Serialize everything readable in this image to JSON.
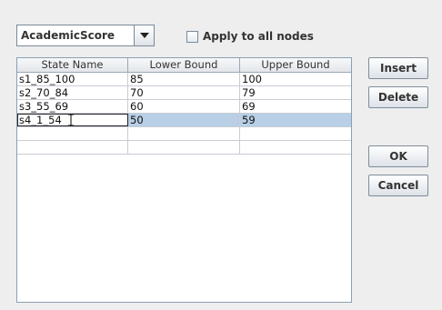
{
  "combo": {
    "value": "AcademicScore"
  },
  "apply_all": {
    "label": "Apply to all nodes",
    "checked": false
  },
  "table": {
    "headers": [
      "State Name",
      "Lower Bound",
      "Upper Bound"
    ],
    "rows": [
      [
        "s1_85_100",
        "85",
        "100"
      ],
      [
        "s2_70_84",
        "70",
        "79"
      ],
      [
        "s3_55_69",
        "60",
        "69"
      ],
      [
        "s4_1_54",
        "50",
        "59"
      ],
      [
        "",
        "",
        ""
      ],
      [
        "",
        "",
        ""
      ]
    ],
    "selected_row": 3
  },
  "buttons": {
    "insert": "Insert",
    "delete": "Delete",
    "ok": "OK",
    "cancel": "Cancel"
  },
  "colors": {
    "selection": "#b8cfe5",
    "background": "#eeeeee"
  }
}
